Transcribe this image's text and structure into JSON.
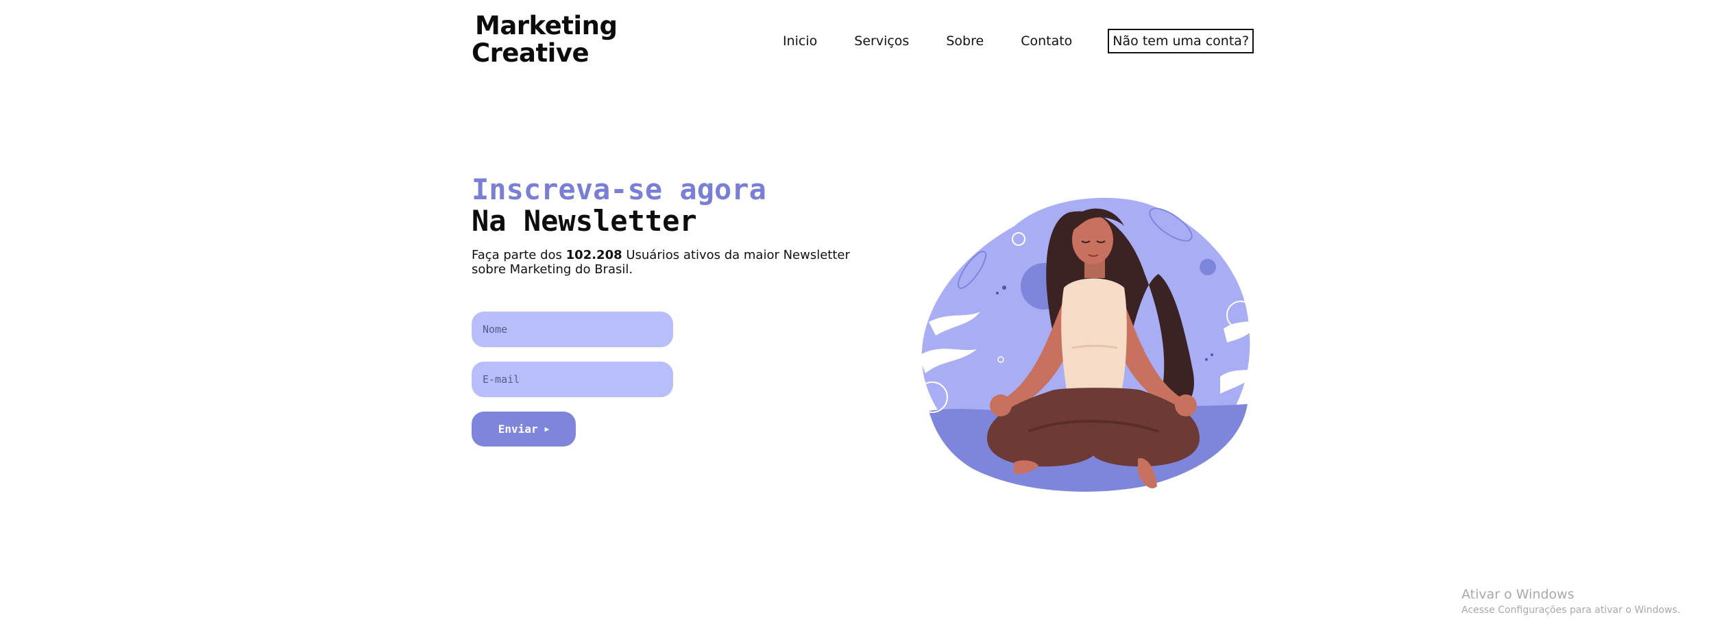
{
  "header": {
    "brand_line1": "Marketing",
    "brand_line2": "Creative",
    "nav": [
      {
        "label": "Inicio"
      },
      {
        "label": "Serviços"
      },
      {
        "label": "Sobre"
      },
      {
        "label": "Contato"
      }
    ],
    "cta_label": "Não tem uma conta?"
  },
  "hero": {
    "title_line1": "Inscreva-se agora",
    "title_line2": "Na Newsletter",
    "desc_pre": "Faça parte dos ",
    "desc_count": "102.208",
    "desc_post": " Usuários ativos da maior Newsletter sobre Marketing do Brasil."
  },
  "form": {
    "name_placeholder": "Nome",
    "email_placeholder": "E-mail",
    "submit_label": "Enviar",
    "submit_icon": "play-arrow-icon"
  },
  "illustration": {
    "name": "meditating-woman-illustration"
  },
  "watermark": {
    "line1": "Ativar o Windows",
    "line2": "Acesse Configurações para ativar o Windows."
  },
  "colors": {
    "accent": "#7a7fd6",
    "input_bg": "#b8befa",
    "button_bg": "#7f85da"
  }
}
